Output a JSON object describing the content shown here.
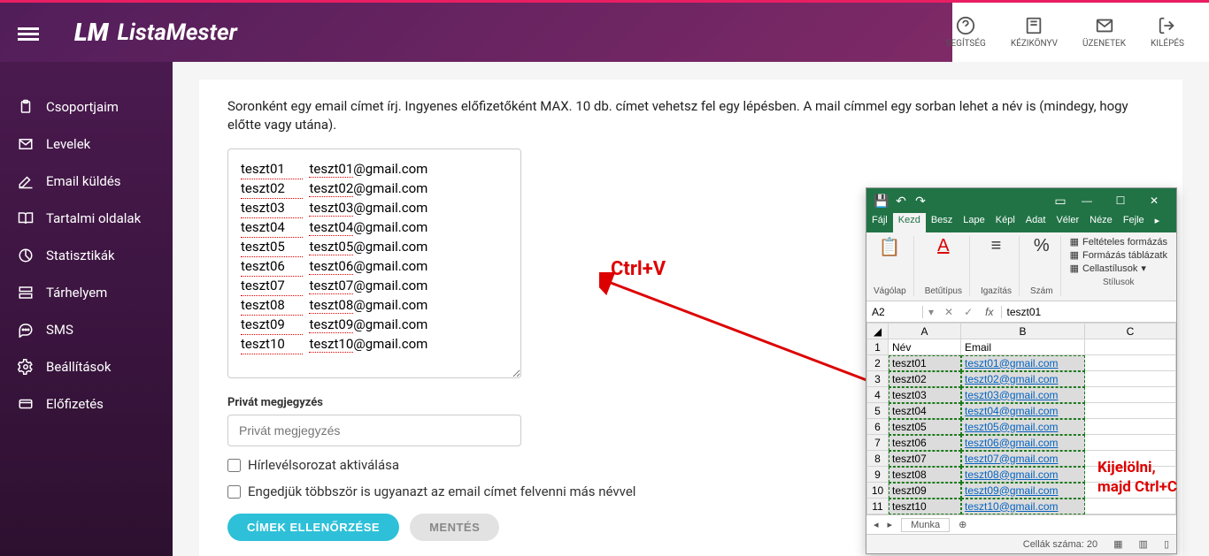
{
  "brand": "ListaMester",
  "header": {
    "help": "SEGÍTSÉG",
    "handbook": "KÉZIKÖNYV",
    "messages": "ÜZENETEK",
    "logout": "KILÉPÉS"
  },
  "sidebar": {
    "items": [
      {
        "label": "Csoportjaim"
      },
      {
        "label": "Levelek"
      },
      {
        "label": "Email küldés"
      },
      {
        "label": "Tartalmi oldalak"
      },
      {
        "label": "Statisztikák"
      },
      {
        "label": "Tárhelyem"
      },
      {
        "label": "SMS"
      },
      {
        "label": "Beállítások"
      },
      {
        "label": "Előfizetés"
      }
    ]
  },
  "main": {
    "instruction": "Soronként egy email címet írj. Ingyenes előfizetőként MAX. 10 db. címet vehetsz fel egy lépésben. A mail címmel egy sorban lehet a név is (mindegy, hogy előtte vagy utána).",
    "textarea": [
      {
        "name": "teszt01",
        "email_user": "teszt01",
        "email_domain": "@gmail.com"
      },
      {
        "name": "teszt02",
        "email_user": "teszt02",
        "email_domain": "@gmail.com"
      },
      {
        "name": "teszt03",
        "email_user": "teszt03",
        "email_domain": "@gmail.com"
      },
      {
        "name": "teszt04",
        "email_user": "teszt04",
        "email_domain": "@gmail.com"
      },
      {
        "name": "teszt05",
        "email_user": "teszt05",
        "email_domain": "@gmail.com"
      },
      {
        "name": "teszt06",
        "email_user": "teszt06",
        "email_domain": "@gmail.com"
      },
      {
        "name": "teszt07",
        "email_user": "teszt07",
        "email_domain": "@gmail.com"
      },
      {
        "name": "teszt08",
        "email_user": "teszt08",
        "email_domain": "@gmail.com"
      },
      {
        "name": "teszt09",
        "email_user": "teszt09",
        "email_domain": "@gmail.com"
      },
      {
        "name": "teszt10",
        "email_user": "teszt10",
        "email_domain": "@gmail.com"
      }
    ],
    "ctrl_v": "Ctrl+V",
    "private_label": "Privát megjegyzés",
    "private_placeholder": "Privát megjegyzés",
    "checkbox1": "Hírlevélsorozat aktiválása",
    "checkbox2": "Engedjük többször is ugyanazt az email címet felvenni más névvel",
    "btn_check": "CÍMEK ELLENŐRZÉSE",
    "btn_save": "MENTÉS"
  },
  "excel": {
    "tabs": [
      "Fájl",
      "Kezd",
      "Besz",
      "Lape",
      "Képl",
      "Adat",
      "Véler",
      "Néze",
      "Fejle"
    ],
    "active_tab": 1,
    "ribbon_groups": [
      "Vágólap",
      "Betűtípus",
      "Igazítás",
      "Szám"
    ],
    "stilus_items": [
      "Feltételes formázás",
      "Formázás táblázatk",
      "Cellastílusok"
    ],
    "stilus_label": "Stílusok",
    "namebox": "A2",
    "fx_value": "teszt01",
    "headers": [
      "A",
      "B",
      "C"
    ],
    "row1": {
      "a": "Név",
      "b": "Email"
    },
    "data": [
      {
        "num": "2",
        "a": "teszt01",
        "b": "teszt01@gmail.com"
      },
      {
        "num": "3",
        "a": "teszt02",
        "b": "teszt02@gmail.com"
      },
      {
        "num": "4",
        "a": "teszt03",
        "b": "teszt03@gmail.com"
      },
      {
        "num": "5",
        "a": "teszt04",
        "b": "teszt04@gmail.com"
      },
      {
        "num": "6",
        "a": "teszt05",
        "b": "teszt05@gmail.com"
      },
      {
        "num": "7",
        "a": "teszt06",
        "b": "teszt06@gmail.com"
      },
      {
        "num": "8",
        "a": "teszt07",
        "b": "teszt07@gmail.com"
      },
      {
        "num": "9",
        "a": "teszt08",
        "b": "teszt08@gmail.com"
      },
      {
        "num": "10",
        "a": "teszt09",
        "b": "teszt09@gmail.com"
      },
      {
        "num": "11",
        "a": "teszt10",
        "b": "teszt10@gmail.com"
      }
    ],
    "sheet_tab": "Munka",
    "status": "Cellák száma: 20",
    "annotation_l1": "Kijelölni,",
    "annotation_l2": "majd Ctrl+C"
  }
}
